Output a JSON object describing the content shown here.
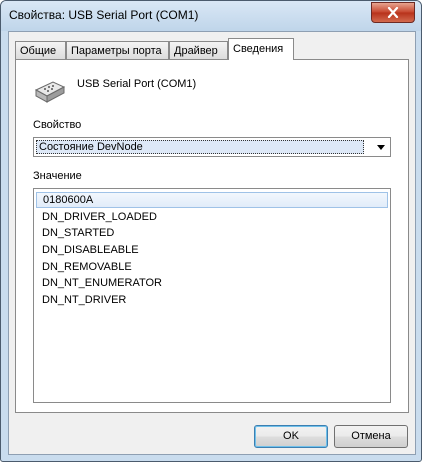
{
  "window": {
    "title": "Свойства: USB Serial Port (COM1)"
  },
  "tabs": [
    {
      "label": "Общие"
    },
    {
      "label": "Параметры порта"
    },
    {
      "label": "Драйвер"
    },
    {
      "label": "Сведения"
    }
  ],
  "active_tab": "Сведения",
  "device": {
    "name": "USB Serial Port (COM1)",
    "icon": "serial-port-connector-icon"
  },
  "property": {
    "label": "Свойство",
    "selected": "Состояние DevNode"
  },
  "value": {
    "label": "Значение",
    "items": [
      "0180600A",
      "DN_DRIVER_LOADED",
      "DN_STARTED",
      "DN_DISABLEABLE",
      "DN_REMOVABLE",
      "DN_NT_ENUMERATOR",
      "DN_NT_DRIVER"
    ],
    "selected_index": 0
  },
  "buttons": {
    "ok": "OK",
    "cancel": "Отмена"
  },
  "colors": {
    "title_bar": "#c9dcee",
    "close_button": "#c7472f",
    "selection": "#dde8f7"
  }
}
